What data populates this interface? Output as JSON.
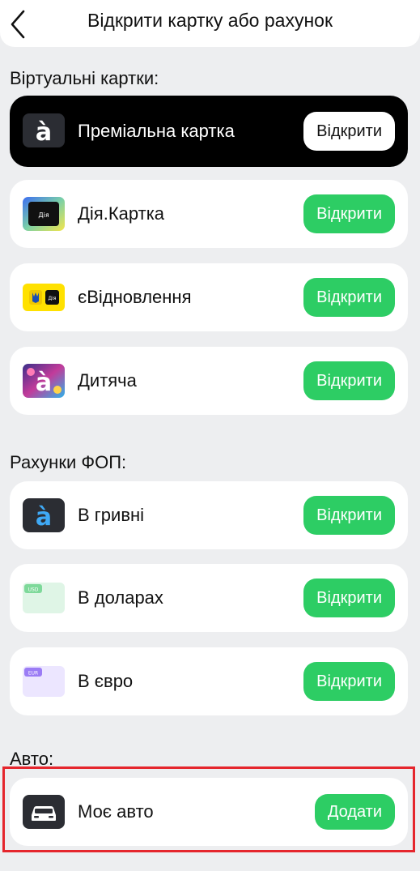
{
  "header": {
    "title": "Відкрити картку або рахунок"
  },
  "sections": {
    "virtual": {
      "title": "Віртуальні картки:"
    },
    "fop": {
      "title": "Рахунки ФОП:"
    },
    "auto": {
      "title": "Авто:"
    }
  },
  "items": {
    "premium": {
      "label": "Преміальна картка",
      "button": "Відкрити",
      "icon": "abank-a-icon"
    },
    "diia": {
      "label": "Дія.Картка",
      "button": "Відкрити",
      "icon": "diia-card-icon",
      "icon_text": "Дія"
    },
    "evidnovlennia": {
      "label": "єВідновлення",
      "button": "Відкрити",
      "icon": "evidnovlennia-icon",
      "icon_text": "Дія"
    },
    "kids": {
      "label": "Дитяча",
      "button": "Відкрити",
      "icon": "kids-card-icon"
    },
    "uah": {
      "label": "В гривні",
      "button": "Відкрити",
      "icon": "abank-a-icon"
    },
    "usd": {
      "label": "В доларах",
      "button": "Відкрити",
      "icon": "usd-card-icon",
      "icon_text": "USD"
    },
    "eur": {
      "label": "В євро",
      "button": "Відкрити",
      "icon": "eur-card-icon",
      "icon_text": "EUR"
    },
    "car": {
      "label": "Моє авто",
      "button": "Додати",
      "icon": "car-icon"
    }
  },
  "colors": {
    "accent_green": "#2dcd64",
    "highlight_red": "#e5262d",
    "background": "#edeef0"
  }
}
